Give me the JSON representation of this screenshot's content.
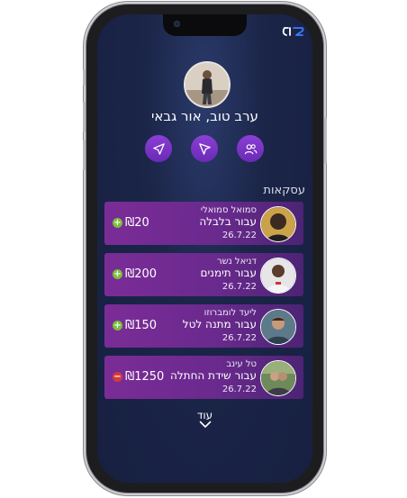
{
  "app": {
    "logo_icon": "app-logo-icon"
  },
  "user": {
    "greeting": "ערב טוב, אור גבאי",
    "avatar_icon": "user-avatar"
  },
  "actions": [
    {
      "icon": "navigate-icon"
    },
    {
      "icon": "send-icon"
    },
    {
      "icon": "contacts-icon"
    }
  ],
  "transactions": {
    "title": "עסקאות",
    "items": [
      {
        "name": "סמואל סמואלי",
        "description": "עבור בלבלה",
        "date": "26.7.22",
        "amount": "₪20",
        "direction": "plus"
      },
      {
        "name": "דניאל נשר",
        "description": "עבור תימנים",
        "date": "26.7.22",
        "amount": "₪200",
        "direction": "plus"
      },
      {
        "name": "ליעד לומברוזו",
        "description": "עבור מתנה לטל",
        "date": "26.7.22",
        "amount": "₪150",
        "direction": "plus"
      },
      {
        "name": "טל עינב",
        "description": "עבור שידת החתלה",
        "date": "26.7.22",
        "amount": "₪1250",
        "direction": "minus"
      }
    ],
    "more_label": "עוד"
  },
  "colors": {
    "background": "#1b2548",
    "accent": "#7b2c97",
    "positive": "#7bbf3a",
    "negative": "#d33a3a"
  }
}
